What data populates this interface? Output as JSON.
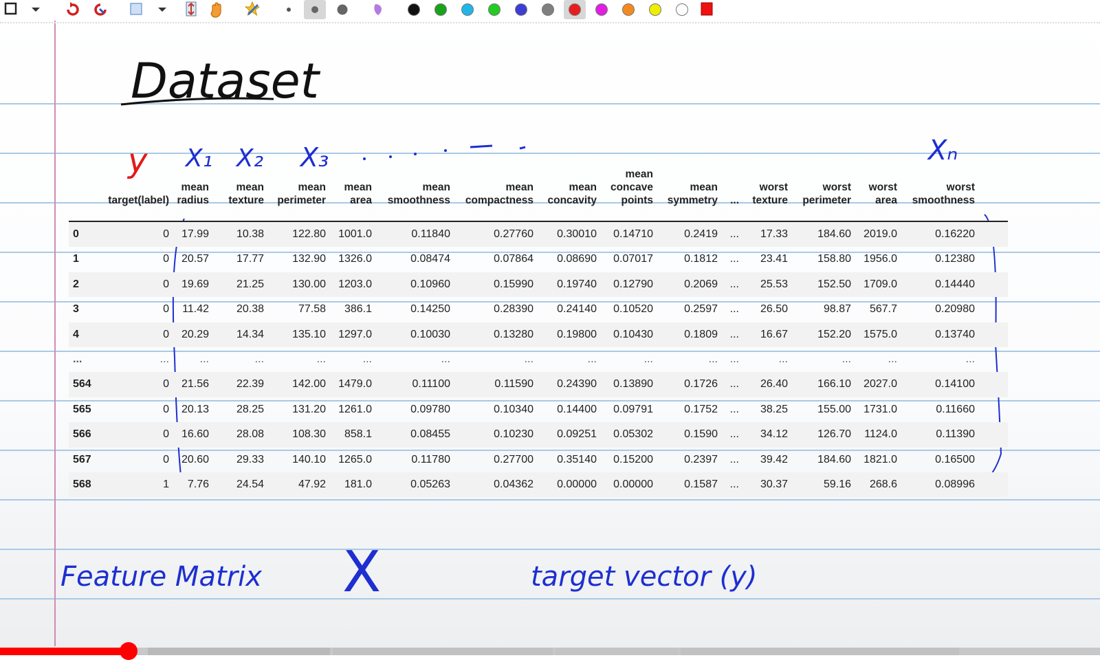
{
  "handwriting": {
    "title": "Dataset",
    "y_label": "y",
    "x1": "X₁",
    "x2": "X₂",
    "x3": "X₃",
    "xn": "Xₙ",
    "feature_matrix": "Feature Matrix",
    "x_big": "X",
    "target_vector": "target vector (y)"
  },
  "toolbar": {
    "colors": [
      "#111111",
      "#1aa21a",
      "#21b5e8",
      "#22cc22",
      "#3d3dd6",
      "#7f7f7f",
      "#e81c1c",
      "#e21ee2",
      "#f5891f",
      "#eeee00",
      "#ffffff"
    ],
    "icons": [
      "select-icon",
      "dropdown-icon",
      "undo-icon",
      "redo-icon",
      "color-picker-icon",
      "dropdown-icon",
      "insert-space-icon",
      "hand-icon",
      "favorite-pen-icon",
      "pen-small-icon",
      "pen-medium-icon",
      "pen-large-icon",
      "highlighter-icon",
      "fill-shape-icon"
    ]
  },
  "table": {
    "columns": [
      {
        "lines": [
          "target(label)"
        ]
      },
      {
        "lines": [
          "mean",
          "radius"
        ]
      },
      {
        "lines": [
          "mean",
          "texture"
        ]
      },
      {
        "lines": [
          "mean",
          "perimeter"
        ]
      },
      {
        "lines": [
          "mean",
          "area"
        ]
      },
      {
        "lines": [
          "mean",
          "smoothness"
        ]
      },
      {
        "lines": [
          "mean",
          "compactness"
        ]
      },
      {
        "lines": [
          "mean",
          "concavity"
        ]
      },
      {
        "lines": [
          "mean",
          "concave",
          "points"
        ]
      },
      {
        "lines": [
          "mean",
          "symmetry"
        ]
      },
      {
        "lines": [
          "..."
        ]
      },
      {
        "lines": [
          "worst",
          "texture"
        ]
      },
      {
        "lines": [
          "worst",
          "perimeter"
        ]
      },
      {
        "lines": [
          "worst",
          "area"
        ]
      },
      {
        "lines": [
          "worst",
          "smoothness"
        ]
      }
    ],
    "rows": [
      {
        "index": "0",
        "values": [
          "0",
          "17.99",
          "10.38",
          "122.80",
          "1001.0",
          "0.11840",
          "0.27760",
          "0.30010",
          "0.14710",
          "0.2419",
          "...",
          "17.33",
          "184.60",
          "2019.0",
          "0.16220"
        ]
      },
      {
        "index": "1",
        "values": [
          "0",
          "20.57",
          "17.77",
          "132.90",
          "1326.0",
          "0.08474",
          "0.07864",
          "0.08690",
          "0.07017",
          "0.1812",
          "...",
          "23.41",
          "158.80",
          "1956.0",
          "0.12380"
        ]
      },
      {
        "index": "2",
        "values": [
          "0",
          "19.69",
          "21.25",
          "130.00",
          "1203.0",
          "0.10960",
          "0.15990",
          "0.19740",
          "0.12790",
          "0.2069",
          "...",
          "25.53",
          "152.50",
          "1709.0",
          "0.14440"
        ]
      },
      {
        "index": "3",
        "values": [
          "0",
          "11.42",
          "20.38",
          "77.58",
          "386.1",
          "0.14250",
          "0.28390",
          "0.24140",
          "0.10520",
          "0.2597",
          "...",
          "26.50",
          "98.87",
          "567.7",
          "0.20980"
        ]
      },
      {
        "index": "4",
        "values": [
          "0",
          "20.29",
          "14.34",
          "135.10",
          "1297.0",
          "0.10030",
          "0.13280",
          "0.19800",
          "0.10430",
          "0.1809",
          "...",
          "16.67",
          "152.20",
          "1575.0",
          "0.13740"
        ]
      },
      {
        "index": "...",
        "values": [
          "...",
          "...",
          "...",
          "...",
          "...",
          "...",
          "...",
          "...",
          "...",
          "...",
          "...",
          "...",
          "...",
          "...",
          "..."
        ]
      },
      {
        "index": "564",
        "values": [
          "0",
          "21.56",
          "22.39",
          "142.00",
          "1479.0",
          "0.11100",
          "0.11590",
          "0.24390",
          "0.13890",
          "0.1726",
          "...",
          "26.40",
          "166.10",
          "2027.0",
          "0.14100"
        ]
      },
      {
        "index": "565",
        "values": [
          "0",
          "20.13",
          "28.25",
          "131.20",
          "1261.0",
          "0.09780",
          "0.10340",
          "0.14400",
          "0.09791",
          "0.1752",
          "...",
          "38.25",
          "155.00",
          "1731.0",
          "0.11660"
        ]
      },
      {
        "index": "566",
        "values": [
          "0",
          "16.60",
          "28.08",
          "108.30",
          "858.1",
          "0.08455",
          "0.10230",
          "0.09251",
          "0.05302",
          "0.1590",
          "...",
          "34.12",
          "126.70",
          "1124.0",
          "0.11390"
        ]
      },
      {
        "index": "567",
        "values": [
          "0",
          "20.60",
          "29.33",
          "140.10",
          "1265.0",
          "0.11780",
          "0.27700",
          "0.35140",
          "0.15200",
          "0.2397",
          "...",
          "39.42",
          "184.60",
          "1821.0",
          "0.16500"
        ]
      },
      {
        "index": "568",
        "values": [
          "1",
          "7.76",
          "24.54",
          "47.92",
          "181.0",
          "0.05263",
          "0.04362",
          "0.00000",
          "0.00000",
          "0.1587",
          "...",
          "30.37",
          "59.16",
          "268.6",
          "0.08996"
        ]
      }
    ]
  },
  "video": {
    "progress_fraction": 0.117
  }
}
